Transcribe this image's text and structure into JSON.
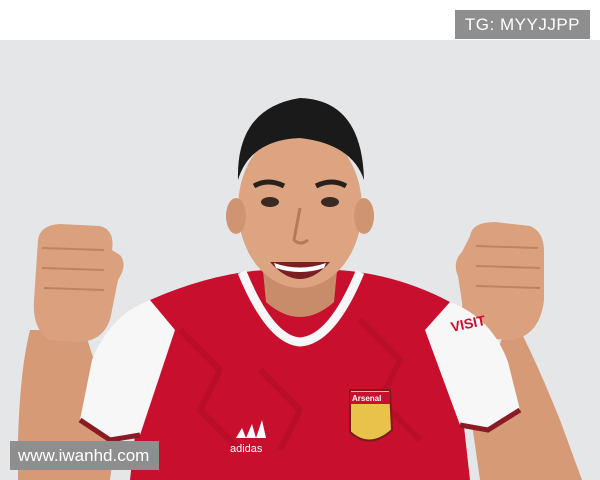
{
  "watermark_top": "TG: MYYJJPP",
  "watermark_bottom": "www.iwanhd.com",
  "photo": {
    "subject": "smiling football player in red and white kit raising both fists",
    "jersey_sponsor": "VISIT",
    "crest_text": "Arsenal",
    "brand_mark": "adidas",
    "colors": {
      "background": "#e4e6e8",
      "jersey_red": "#c8102e",
      "sleeve_white": "#f7f7f7",
      "skin": "#d9a07c",
      "hair": "#1b1a1a"
    }
  }
}
